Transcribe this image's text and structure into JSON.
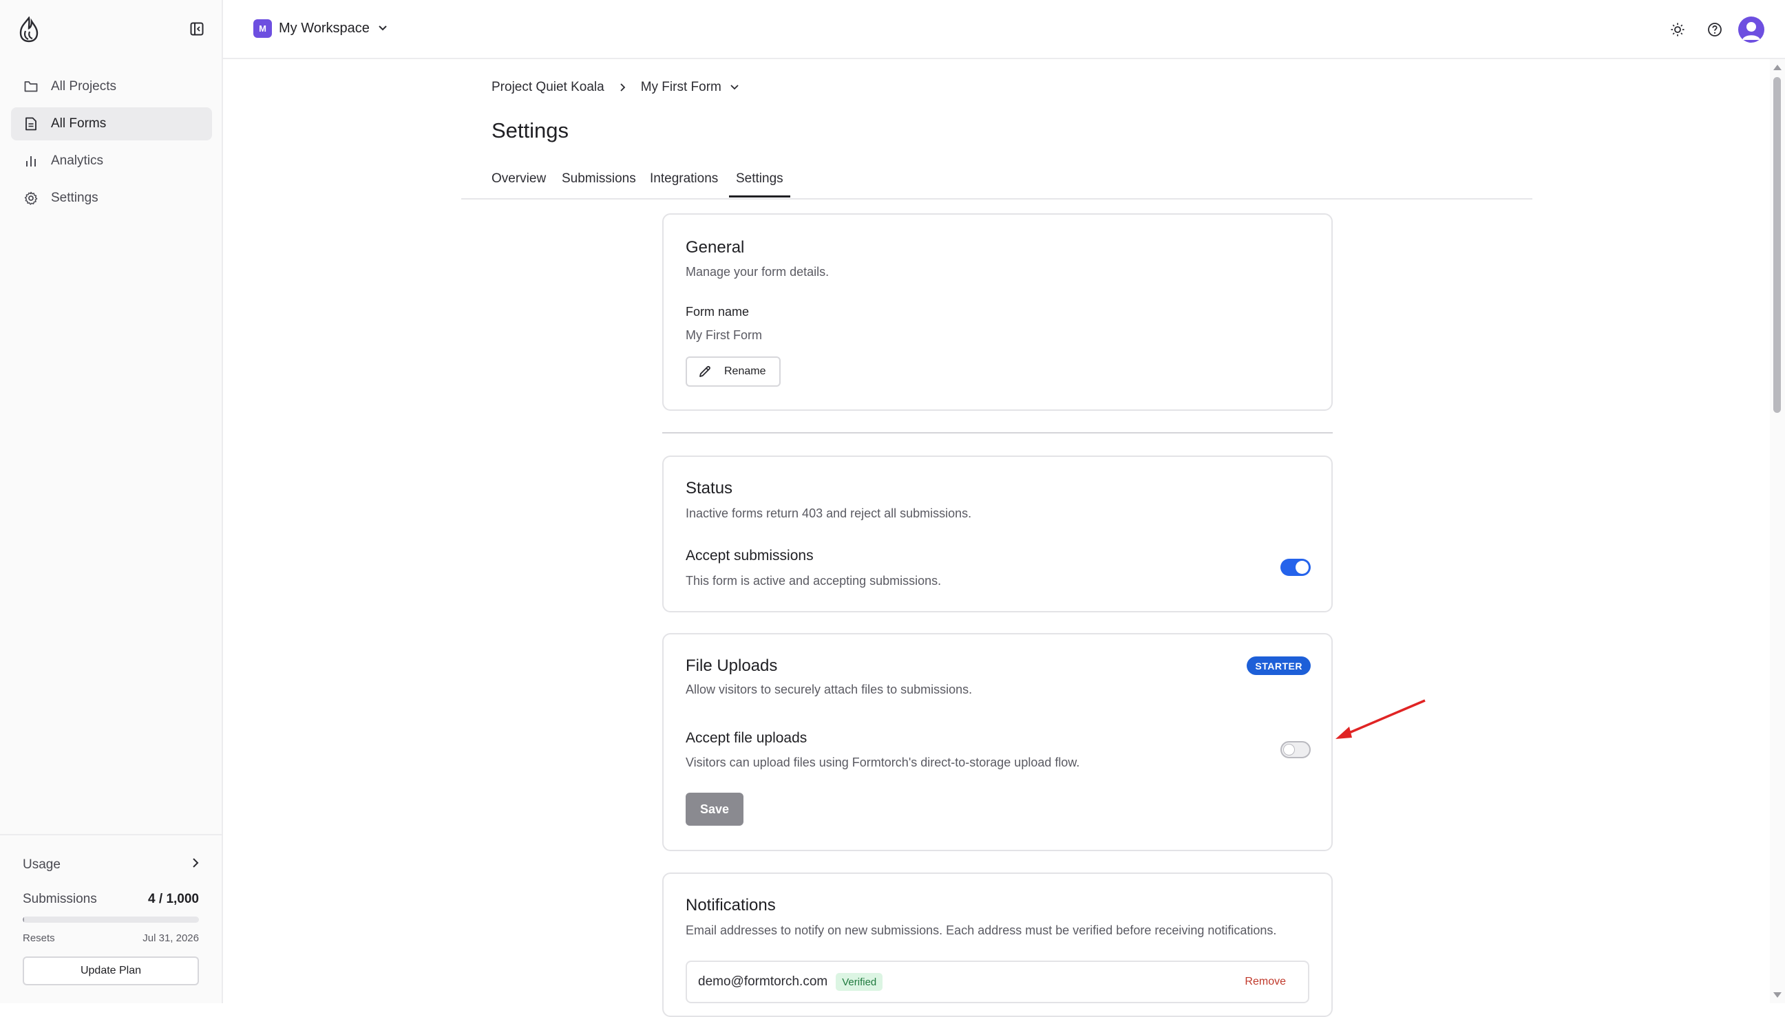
{
  "sidebar": {
    "nav": [
      {
        "label": "All Projects",
        "icon": "folder-icon",
        "active": false
      },
      {
        "label": "All Forms",
        "icon": "document-icon",
        "active": true
      },
      {
        "label": "Analytics",
        "icon": "bar-chart-icon",
        "active": false
      },
      {
        "label": "Settings",
        "icon": "gear-icon",
        "active": false
      }
    ],
    "usage": {
      "title": "Usage",
      "submissions_label": "Submissions",
      "submissions_value": "4 / 1,000",
      "progress_fraction": 0.004,
      "resets_label": "Resets",
      "resets_date": "Jul 31, 2026",
      "update_plan_label": "Update Plan"
    }
  },
  "topbar": {
    "workspace_initial": "M",
    "workspace_name": "My Workspace",
    "icons": [
      "sun-icon",
      "help-icon",
      "user-avatar-icon"
    ]
  },
  "header": {
    "breadcrumb": {
      "project": "Project Quiet Koala",
      "form": "My First Form"
    },
    "title": "Settings",
    "tabs": [
      {
        "label": "Overview",
        "active": false
      },
      {
        "label": "Submissions",
        "active": false
      },
      {
        "label": "Integrations",
        "active": false
      },
      {
        "label": "Settings",
        "active": true
      }
    ]
  },
  "general": {
    "title": "General",
    "description": "Manage your form details.",
    "form_name_label": "Form name",
    "form_name_value": "My First Form",
    "rename_label": "Rename"
  },
  "status": {
    "title": "Status",
    "description": "Inactive forms return 403 and reject all submissions.",
    "accept_label": "Accept submissions",
    "accept_description": "This form is active and accepting submissions.",
    "accept_enabled": true
  },
  "file_uploads": {
    "title": "File Uploads",
    "badge": "STARTER",
    "description": "Allow visitors to securely attach files to submissions.",
    "accept_label": "Accept file uploads",
    "accept_description": "Visitors can upload files using Formtorch's direct-to-storage upload flow.",
    "accept_enabled": false,
    "save_label": "Save"
  },
  "notifications": {
    "title": "Notifications",
    "description": "Email addresses to notify on new submissions. Each address must be verified before receiving notifications.",
    "recipients": [
      {
        "email": "demo@formtorch.com",
        "status": "Verified",
        "action": "Remove"
      }
    ]
  },
  "colors": {
    "accent_blue": "#2563eb",
    "workspace_purple": "#6d4fe0",
    "annotation_red": "#e02424"
  }
}
